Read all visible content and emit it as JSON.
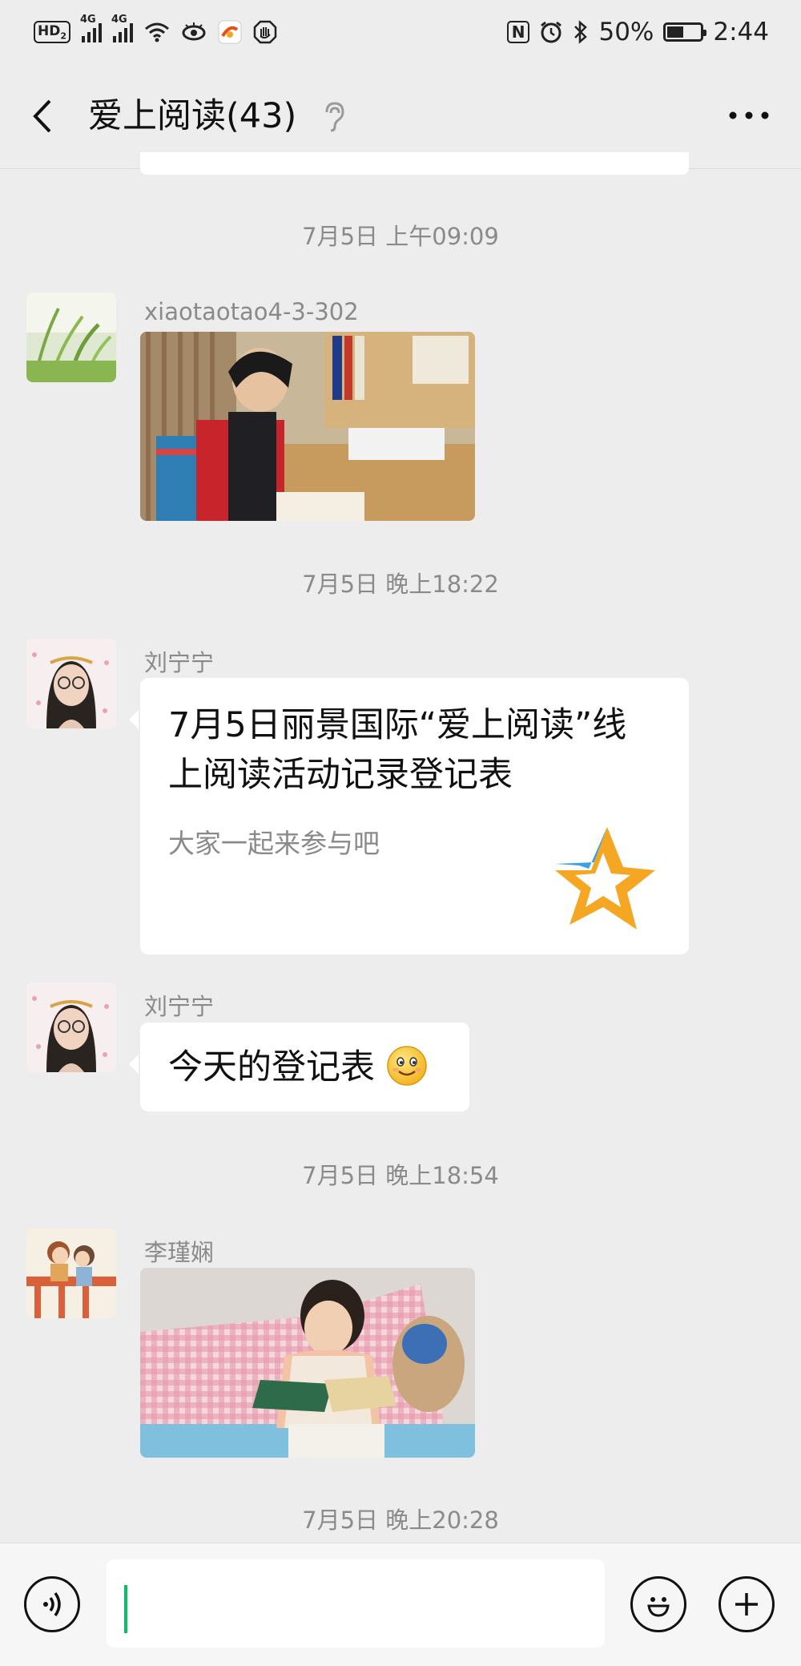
{
  "status_bar": {
    "hd_label": "HD",
    "hd_sub": "2",
    "network_1": "4G",
    "network_2": "4G",
    "nfc_label": "N",
    "battery_text": "50%",
    "battery_level": 0.5,
    "time": "2:44",
    "icons": [
      "hd-icon",
      "signal-icon",
      "wifi-icon",
      "eye-icon",
      "app-icon",
      "shield-icon",
      "nfc-icon",
      "alarm-icon",
      "bluetooth-icon",
      "battery-icon"
    ]
  },
  "header": {
    "back_icon": "chevron-left-icon",
    "title": "爱上阅读(43)",
    "ear_icon": "ear-icon",
    "more_icon": "more-icon"
  },
  "messages": [
    {
      "type": "timestamp",
      "text": "7月5日 上午09:09"
    },
    {
      "type": "image",
      "sender": "xiaotaotao4-3-302",
      "avatar": "grass-avatar",
      "image_desc": "photo-girl-reading-at-desk"
    },
    {
      "type": "timestamp",
      "text": "7月5日 晚上18:22"
    },
    {
      "type": "card",
      "sender": "刘宁宁",
      "avatar": "woman-glasses-avatar",
      "title": "7月5日丽景国际“爱上阅读”线上阅读活动记录登记表",
      "subtitle": "大家一起来参与吧",
      "card_icon": "star-icon",
      "colors": {
        "star_orange": "#f5a623",
        "star_blue": "#3aa0e8"
      }
    },
    {
      "type": "text",
      "sender": "刘宁宁",
      "avatar": "woman-glasses-avatar",
      "text": "今天的登记表",
      "emoji": "smile-emoji-icon"
    },
    {
      "type": "timestamp",
      "text": "7月5日 晚上18:54"
    },
    {
      "type": "image",
      "sender": "李瑾娴",
      "avatar": "illustration-avatar",
      "image_desc": "photo-child-reading-on-bed"
    },
    {
      "type": "timestamp",
      "text": "7月5日 晚上20:28"
    }
  ],
  "input_bar": {
    "voice_icon": "voice-icon",
    "text_value": "",
    "emoji_icon": "emoji-icon",
    "plus_icon": "plus-icon",
    "caret_color": "#07c160"
  }
}
